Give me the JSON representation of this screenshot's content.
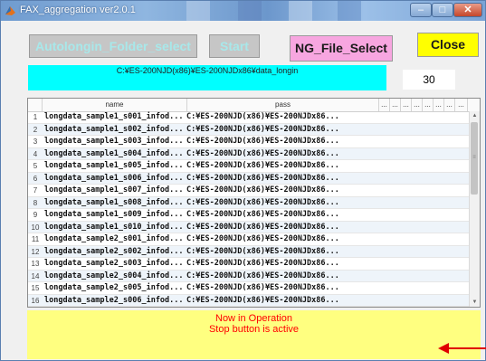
{
  "window": {
    "title": "FAX_aggregation  ver2.0.1",
    "min_label": "–",
    "max_label": "□",
    "close_label": "✕",
    "icon": "matlab-icon"
  },
  "toolbar": {
    "folder_select_label": "Autolongin_Folder_select",
    "start_label": "Start",
    "ng_file_select_label": "NG_File_Select",
    "close_label": "Close"
  },
  "path": "C:¥ES-200NJD(x86)¥ES-200NJDx86¥data_longin",
  "count": "30",
  "table": {
    "columns": [
      "name",
      "pass",
      "...",
      "...",
      "...",
      "...",
      "...",
      "...",
      "...",
      "..."
    ],
    "rows": [
      {
        "idx": "1",
        "name": "longdata_sample1_s001_infod...",
        "pass": "C:¥ES-200NJD(x86)¥ES-200NJDx86..."
      },
      {
        "idx": "2",
        "name": "longdata_sample1_s002_infod...",
        "pass": "C:¥ES-200NJD(x86)¥ES-200NJDx86..."
      },
      {
        "idx": "3",
        "name": "longdata_sample1_s003_infod...",
        "pass": "C:¥ES-200NJD(x86)¥ES-200NJDx86..."
      },
      {
        "idx": "4",
        "name": "longdata_sample1_s004_infod...",
        "pass": "C:¥ES-200NJD(x86)¥ES-200NJDx86..."
      },
      {
        "idx": "5",
        "name": "longdata_sample1_s005_infod...",
        "pass": "C:¥ES-200NJD(x86)¥ES-200NJDx86..."
      },
      {
        "idx": "6",
        "name": "longdata_sample1_s006_infod...",
        "pass": "C:¥ES-200NJD(x86)¥ES-200NJDx86..."
      },
      {
        "idx": "7",
        "name": "longdata_sample1_s007_infod...",
        "pass": "C:¥ES-200NJD(x86)¥ES-200NJDx86..."
      },
      {
        "idx": "8",
        "name": "longdata_sample1_s008_infod...",
        "pass": "C:¥ES-200NJD(x86)¥ES-200NJDx86..."
      },
      {
        "idx": "9",
        "name": "longdata_sample1_s009_infod...",
        "pass": "C:¥ES-200NJD(x86)¥ES-200NJDx86..."
      },
      {
        "idx": "10",
        "name": "longdata_sample1_s010_infod...",
        "pass": "C:¥ES-200NJD(x86)¥ES-200NJDx86..."
      },
      {
        "idx": "11",
        "name": "longdata_sample2_s001_infod...",
        "pass": "C:¥ES-200NJD(x86)¥ES-200NJDx86..."
      },
      {
        "idx": "12",
        "name": "longdata_sample2_s002_infod...",
        "pass": "C:¥ES-200NJD(x86)¥ES-200NJDx86..."
      },
      {
        "idx": "13",
        "name": "longdata_sample2_s003_infod...",
        "pass": "C:¥ES-200NJD(x86)¥ES-200NJDx86..."
      },
      {
        "idx": "14",
        "name": "longdata_sample2_s004_infod...",
        "pass": "C:¥ES-200NJD(x86)¥ES-200NJDx86..."
      },
      {
        "idx": "15",
        "name": "longdata_sample2_s005_infod...",
        "pass": "C:¥ES-200NJD(x86)¥ES-200NJDx86..."
      },
      {
        "idx": "16",
        "name": "longdata_sample2_s006_infod...",
        "pass": "C:¥ES-200NJD(x86)¥ES-200NJDx86..."
      }
    ]
  },
  "status": {
    "line1": "Now in Operation",
    "line2": "Stop button is active"
  },
  "colors": {
    "path_bg": "#00ffff",
    "ng_button": "#f7a6e0",
    "close_button": "#ffff00",
    "status_bg": "#ffff80",
    "status_text": "#ff0000",
    "arrow": "#e00000"
  }
}
